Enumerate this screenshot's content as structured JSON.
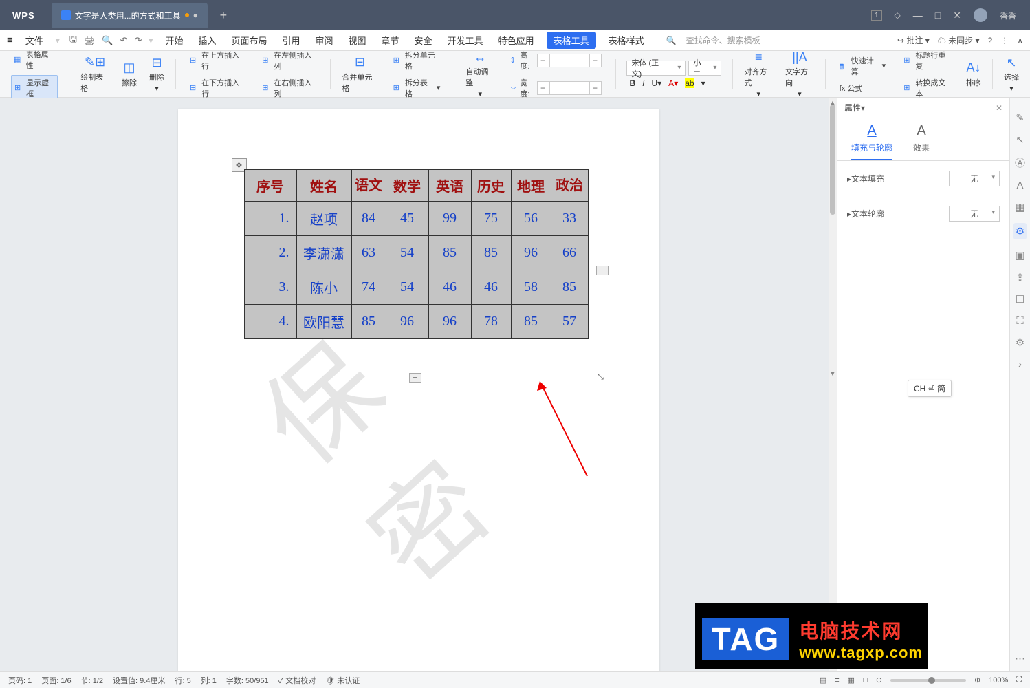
{
  "titlebar": {
    "app": "WPS",
    "tab_label": "文字是人类用...的方式和工具",
    "user": "香香"
  },
  "menu": {
    "file": "文件",
    "items": [
      "开始",
      "插入",
      "页面布局",
      "引用",
      "审阅",
      "视图",
      "章节",
      "安全",
      "开发工具",
      "特色应用",
      "表格工具",
      "表格样式"
    ],
    "active_index": 10,
    "search_placeholder": "查找命令、搜索模板",
    "annotate": "批注",
    "sync": "未同步"
  },
  "ribbon": {
    "table_props": "表格属性",
    "show_frame": "显示虚框",
    "draw_table": "绘制表格",
    "eraser": "擦除",
    "delete": "删除",
    "insert_row_above": "在上方插入行",
    "insert_row_below": "在下方插入行",
    "insert_col_left": "在左侧插入列",
    "insert_col_right": "在右侧插入列",
    "merge_cells": "合并单元格",
    "split_cells": "拆分单元格",
    "split_table": "拆分表格",
    "autofit": "自动调整",
    "height_label": "高度:",
    "width_label": "宽度:",
    "font_name": "宋体 (正文)",
    "font_size": "小二",
    "align": "对齐方式",
    "text_direction": "文字方向",
    "quick_calc": "快速计算",
    "formula": "fx 公式",
    "title_repeat": "标题行重复",
    "to_text": "转换成文本",
    "sort": "排序",
    "select": "选择"
  },
  "table": {
    "headers": [
      "序号",
      "姓名",
      "语文",
      "数学",
      "英语",
      "历史",
      "地理",
      "政治"
    ],
    "rows": [
      {
        "idx": "1.",
        "name": "赵项",
        "chinese": "84",
        "math": "45",
        "english": "99",
        "history": "75",
        "geo": "56",
        "politics": "33"
      },
      {
        "idx": "2.",
        "name": "李潇潇",
        "chinese": "63",
        "math": "54",
        "english": "85",
        "history": "85",
        "geo": "96",
        "politics": "66"
      },
      {
        "idx": "3.",
        "name": "陈小",
        "chinese": "74",
        "math": "54",
        "english": "46",
        "history": "46",
        "geo": "58",
        "politics": "85"
      },
      {
        "idx": "4.",
        "name": "欧阳慧",
        "chinese": "85",
        "math": "96",
        "english": "96",
        "history": "78",
        "geo": "85",
        "politics": "57"
      }
    ]
  },
  "watermark": "保密",
  "panel": {
    "title": "属性",
    "tab_fill": "填充与轮廓",
    "tab_effect": "效果",
    "text_fill": "文本填充",
    "text_outline": "文本轮廓",
    "none": "无"
  },
  "ime": "CH ⏎ 简",
  "status": {
    "page_no": "页码: 1",
    "page": "页面: 1/6",
    "section": "节: 1/2",
    "setval": "设置值: 9.4厘米",
    "line": "行: 5",
    "col": "列: 1",
    "words": "字数: 50/951",
    "proof": "文档校对",
    "unverified": "未认证",
    "zoom": "100%"
  },
  "tag": {
    "label": "TAG",
    "line1": "电脑技术网",
    "line2": "www.tagxp.com"
  }
}
